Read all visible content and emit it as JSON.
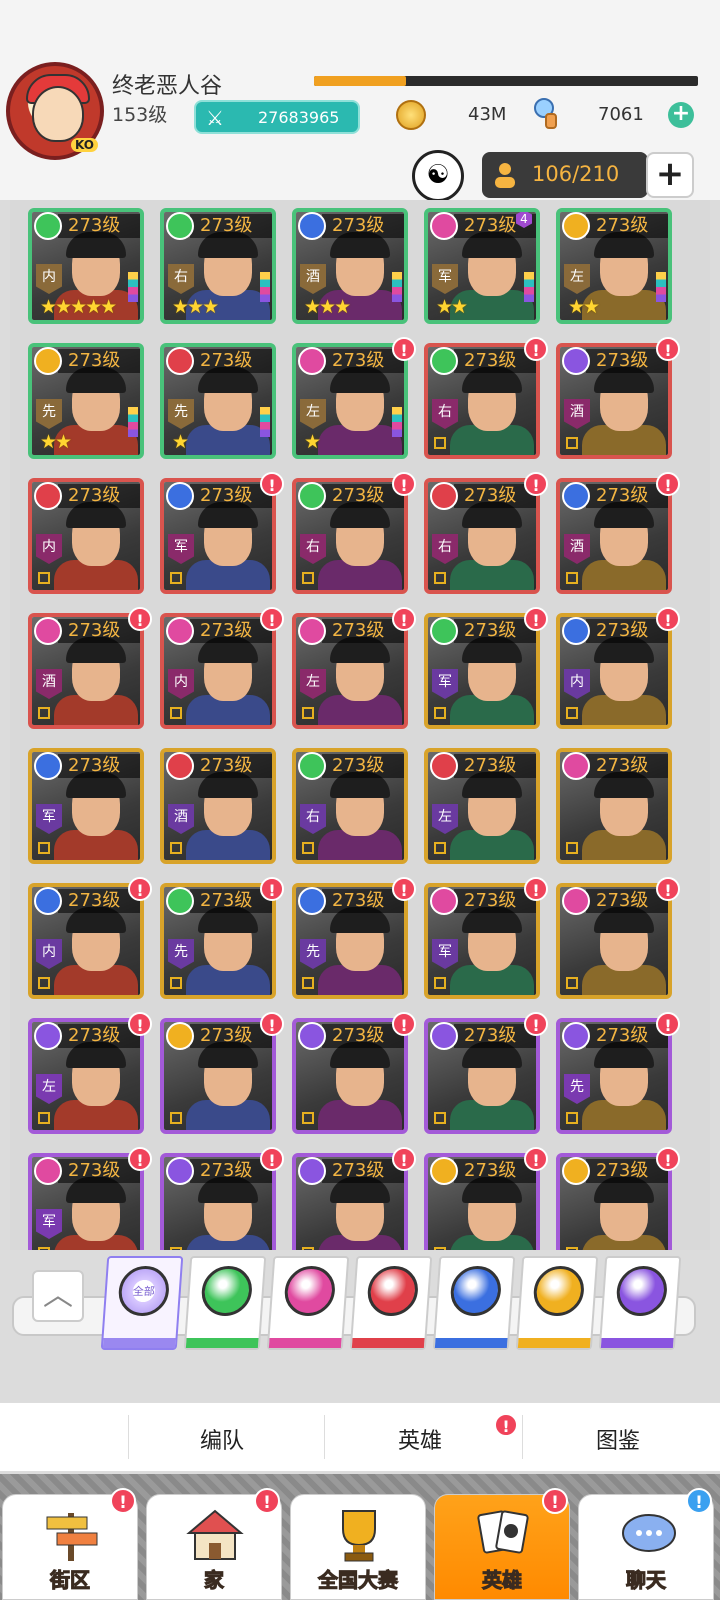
{
  "player": {
    "name": "终老恶人谷",
    "level": "153级",
    "power": "27683965",
    "xp_fraction": 0.24,
    "coins": "43M",
    "gems": "7061",
    "avatar_badge": "KO"
  },
  "roster": {
    "capacity": "106/210"
  },
  "colors": {
    "green": "#3ec45a",
    "pink": "#e04aa0",
    "red": "#e0404a",
    "blue": "#3b6fe0",
    "gold": "#f0b020",
    "purple": "#8a55e0"
  },
  "heroes": [
    {
      "level": "273级",
      "faction": "green",
      "cls": "内",
      "frame": "green",
      "stars": "★★★★★",
      "badge": ""
    },
    {
      "level": "273级",
      "faction": "green",
      "cls": "右",
      "frame": "green",
      "stars": "★★★",
      "badge": ""
    },
    {
      "level": "273级",
      "faction": "blue",
      "cls": "酒",
      "frame": "green",
      "stars": "★★★",
      "badge": ""
    },
    {
      "level": "273级",
      "faction": "pink",
      "cls": "军",
      "frame": "green",
      "stars": "★★",
      "badge": "4"
    },
    {
      "level": "273级",
      "faction": "gold",
      "cls": "左",
      "frame": "green",
      "stars": "★★",
      "badge": ""
    },
    {
      "level": "273级",
      "faction": "gold",
      "cls": "先",
      "frame": "green",
      "stars": "★★",
      "badge": ""
    },
    {
      "level": "273级",
      "faction": "red",
      "cls": "先",
      "frame": "green",
      "stars": "★",
      "badge": ""
    },
    {
      "level": "273级",
      "faction": "pink",
      "cls": "左",
      "frame": "green",
      "stars": "★",
      "badge": "!"
    },
    {
      "level": "273级",
      "faction": "green",
      "cls": "右",
      "frame": "red",
      "stars": "",
      "badge": "!"
    },
    {
      "level": "273级",
      "faction": "purple",
      "cls": "酒",
      "frame": "red",
      "stars": "",
      "badge": "!"
    },
    {
      "level": "273级",
      "faction": "red",
      "cls": "内",
      "frame": "red",
      "stars": "",
      "badge": ""
    },
    {
      "level": "273级",
      "faction": "blue",
      "cls": "军",
      "frame": "red",
      "stars": "",
      "badge": "!"
    },
    {
      "level": "273级",
      "faction": "green",
      "cls": "右",
      "frame": "red",
      "stars": "",
      "badge": "!"
    },
    {
      "level": "273级",
      "faction": "red",
      "cls": "右",
      "frame": "red",
      "stars": "",
      "badge": "!"
    },
    {
      "level": "273级",
      "faction": "blue",
      "cls": "酒",
      "frame": "red",
      "stars": "",
      "badge": "!"
    },
    {
      "level": "273级",
      "faction": "pink",
      "cls": "酒",
      "frame": "red",
      "stars": "",
      "badge": "!"
    },
    {
      "level": "273级",
      "faction": "pink",
      "cls": "内",
      "frame": "red",
      "stars": "",
      "badge": "!"
    },
    {
      "level": "273级",
      "faction": "pink",
      "cls": "左",
      "frame": "red",
      "stars": "",
      "badge": "!"
    },
    {
      "level": "273级",
      "faction": "green",
      "cls": "军",
      "frame": "gold",
      "stars": "",
      "badge": "!"
    },
    {
      "level": "273级",
      "faction": "blue",
      "cls": "内",
      "frame": "gold",
      "stars": "",
      "badge": "!"
    },
    {
      "level": "273级",
      "faction": "blue",
      "cls": "军",
      "frame": "gold",
      "stars": "",
      "badge": ""
    },
    {
      "level": "273级",
      "faction": "red",
      "cls": "酒",
      "frame": "gold",
      "stars": "",
      "badge": ""
    },
    {
      "level": "273级",
      "faction": "green",
      "cls": "右",
      "frame": "gold",
      "stars": "",
      "badge": ""
    },
    {
      "level": "273级",
      "faction": "red",
      "cls": "左",
      "frame": "gold",
      "stars": "",
      "badge": ""
    },
    {
      "level": "273级",
      "faction": "pink",
      "cls": "",
      "frame": "gold",
      "stars": "",
      "badge": ""
    },
    {
      "level": "273级",
      "faction": "blue",
      "cls": "内",
      "frame": "gold",
      "stars": "",
      "badge": "!"
    },
    {
      "level": "273级",
      "faction": "green",
      "cls": "先",
      "frame": "gold",
      "stars": "",
      "badge": "!"
    },
    {
      "level": "273级",
      "faction": "blue",
      "cls": "先",
      "frame": "gold",
      "stars": "",
      "badge": "!"
    },
    {
      "level": "273级",
      "faction": "pink",
      "cls": "军",
      "frame": "gold",
      "stars": "",
      "badge": "!"
    },
    {
      "level": "273级",
      "faction": "pink",
      "cls": "",
      "frame": "gold",
      "stars": "",
      "badge": "!"
    },
    {
      "level": "273级",
      "faction": "purple",
      "cls": "左",
      "frame": "purple",
      "stars": "",
      "badge": "!"
    },
    {
      "level": "273级",
      "faction": "gold",
      "cls": "",
      "frame": "purple",
      "stars": "",
      "badge": "!"
    },
    {
      "level": "273级",
      "faction": "purple",
      "cls": "",
      "frame": "purple",
      "stars": "",
      "badge": "!"
    },
    {
      "level": "273级",
      "faction": "purple",
      "cls": "",
      "frame": "purple",
      "stars": "",
      "badge": "!"
    },
    {
      "level": "273级",
      "faction": "purple",
      "cls": "先",
      "frame": "purple",
      "stars": "",
      "badge": "!"
    },
    {
      "level": "273级",
      "faction": "pink",
      "cls": "军",
      "frame": "purple",
      "stars": "",
      "badge": "!"
    },
    {
      "level": "273级",
      "faction": "purple",
      "cls": "",
      "frame": "purple",
      "stars": "",
      "badge": "!"
    },
    {
      "level": "273级",
      "faction": "purple",
      "cls": "",
      "frame": "purple",
      "stars": "",
      "badge": "!"
    },
    {
      "level": "273级",
      "faction": "gold",
      "cls": "",
      "frame": "purple",
      "stars": "",
      "badge": "!"
    },
    {
      "level": "273级",
      "faction": "gold",
      "cls": "",
      "frame": "purple",
      "stars": "",
      "badge": "!"
    }
  ],
  "filters": [
    {
      "id": "all",
      "label": "全部",
      "color": "#9a88f0",
      "selected": true
    },
    {
      "id": "green",
      "label": "",
      "color": "#3ec45a",
      "selected": false
    },
    {
      "id": "pink",
      "label": "",
      "color": "#e04aa0",
      "selected": false
    },
    {
      "id": "red",
      "label": "",
      "color": "#e0404a",
      "selected": false
    },
    {
      "id": "blue",
      "label": "",
      "color": "#3b6fe0",
      "selected": false
    },
    {
      "id": "gold",
      "label": "",
      "color": "#f0b020",
      "selected": false
    },
    {
      "id": "purple",
      "label": "",
      "color": "#8a55e0",
      "selected": false
    }
  ],
  "subnav": {
    "team": "编队",
    "heroes": "英雄",
    "codex": "图鉴",
    "badge": "!"
  },
  "bottomnav": [
    {
      "label": "街区",
      "icon": "signpost-icon",
      "badge": "!",
      "active": false
    },
    {
      "label": "家",
      "icon": "house-icon",
      "badge": "!",
      "active": false
    },
    {
      "label": "全国大赛",
      "icon": "trophy-icon",
      "badge": "",
      "active": false
    },
    {
      "label": "英雄",
      "icon": "hero-cards-icon",
      "badge": "!",
      "active": true
    },
    {
      "label": "聊天",
      "icon": "chat-icon",
      "badge": "!",
      "active": false
    }
  ]
}
